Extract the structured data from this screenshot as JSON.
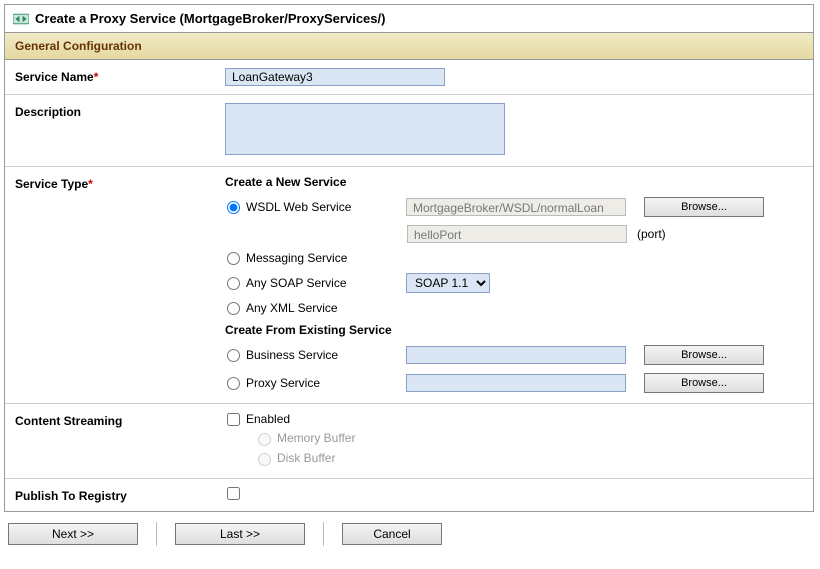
{
  "header": {
    "title": "Create a Proxy Service (MortgageBroker/ProxyServices/)"
  },
  "section": {
    "general": "General Configuration"
  },
  "labels": {
    "service_name": "Service Name",
    "description": "Description",
    "service_type": "Service Type",
    "content_streaming": "Content Streaming",
    "publish_registry": "Publish To Registry"
  },
  "values": {
    "service_name": "LoanGateway3",
    "wsdl_path": "MortgageBroker/WSDL/normalLoan",
    "wsdl_port": "helloPort",
    "port_suffix": "(port)"
  },
  "service_type": {
    "create_new_heading": "Create a New Service",
    "create_existing_heading": "Create From Existing Service",
    "wsdl": "WSDL Web Service",
    "messaging": "Messaging Service",
    "soap": "Any SOAP Service",
    "soap_version": "SOAP 1.1",
    "xml": "Any XML Service",
    "business": "Business Service",
    "proxy": "Proxy Service"
  },
  "streaming": {
    "enabled": "Enabled",
    "memory": "Memory Buffer",
    "disk": "Disk Buffer"
  },
  "buttons": {
    "browse": "Browse...",
    "next": "Next >>",
    "last": "Last >>",
    "cancel": "Cancel"
  }
}
